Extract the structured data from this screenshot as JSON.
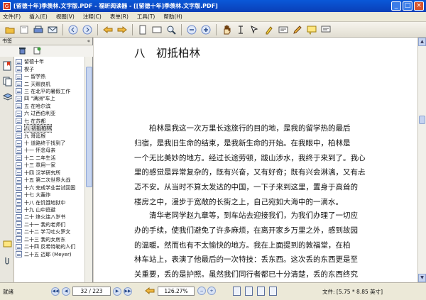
{
  "window": {
    "title": "[留德十年]季羡林.文字版.PDF - 福昕阅读器 - [[留德十年]季羡林.文字版.PDF]",
    "app_icon": "G",
    "controls": [
      "_",
      "□",
      "×"
    ]
  },
  "menu": [
    "文件(F)",
    "插入(E)",
    "视图(V)",
    "注释(C)",
    "表单(R)",
    "工具(T)",
    "帮助(H)"
  ],
  "sidebar": {
    "header": "书签",
    "collapse": "«",
    "bookmarks": [
      "留德十年",
      "楔子",
      "一 留学热",
      "二 天赐良机",
      "三 在北平的暑假工作",
      "四 \"满洲\"车上",
      "五 在哈尔滨",
      "六 过西伯利亚",
      "七 在苏都",
      "八 初抵柏林",
      "九 哥廷根",
      "十 道路终于找到了",
      "十一 怀念母亲",
      "十二 二年生活",
      "十三 章用一家",
      "十四 汉学研究所",
      "十五 第二次世界大战",
      "十六 完成学业尝试回国",
      "十七 大轰炸",
      "十八 在饥饿地狱中",
      "十九 山中逃避",
      "二十 烽火连八岁书",
      "二十一 我的老师们",
      "二十二 学习吐火罗文",
      "二十三 我的女房东",
      "二十四 反希特勒的人们",
      "二十五 迈耶 (Meyer)"
    ],
    "selected_index": 9
  },
  "document": {
    "chapter_title": "八　初抵柏林",
    "paragraph1": [
      "柏林是我这一次万里长途旅行的目的地，是我的留学热的最后",
      "归宿，是我旧生命的结束，是我新生命的开始。在我眼中，柏林是",
      "一个无比美妙的地方。经过长途劳顿，跋山涉水，我终于来到了。我心",
      "里的感觉是异常复杂的，既有兴奋，又有好奇；既有兴会淋漓，又有忐",
      "忑不安。从当时不算太发达的中国，一下子来到这里，置身于高耸的",
      "楼房之中，漫步于宽敞的长街之上，自己宛如大海中的一滴水。"
    ],
    "paragraph2": [
      "清华老同学赵九章等，到车站去迎接我们，为我们办理了一切应",
      "办的手续，使我们避免了许多麻烦，在离开家乡万里之外，感到故园",
      "的温暖。然而也有不太愉快的地方。我在上面提到的敦福堂，在柏",
      "林车站上，表演了他最后的一次特技：丢东西。这次丢的东西更是至",
      "关重要，丢的是护照。虽然我们同行者都已十分清楚，丢的东西终究"
    ]
  },
  "status": {
    "ready": "就绪",
    "page": "32 / 223",
    "zoom": "126.27%",
    "doc_size": "文件: [5.75 * 8.85 英寸]"
  },
  "colors": {
    "titlebar": "#0a4fc8",
    "icon_red": "#d93b1d"
  }
}
